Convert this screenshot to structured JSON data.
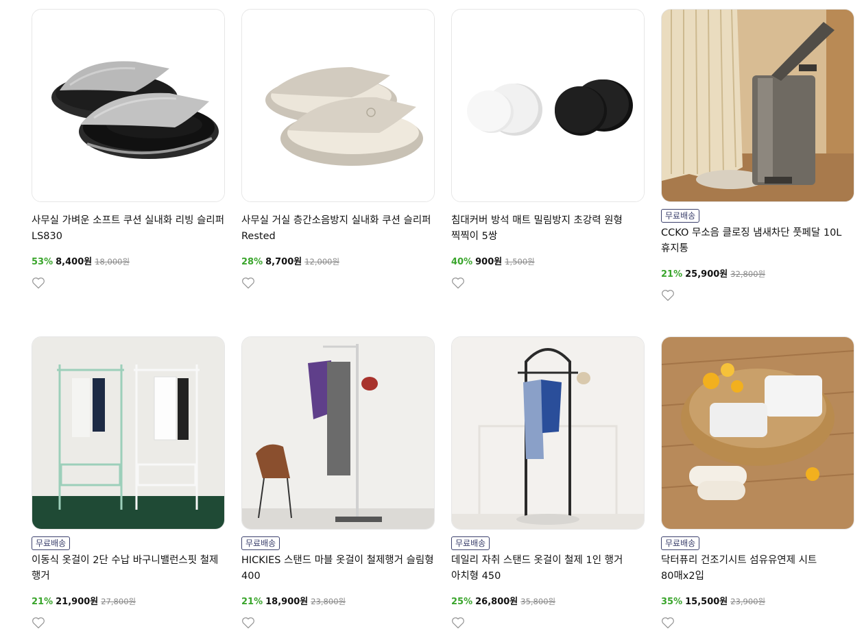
{
  "products": [
    {
      "name": "사무실 가벼운 소프트 쿠션 실내화 리빙 슬리퍼 LS830",
      "discount": "53%",
      "price": "8,400원",
      "original": "18,000원",
      "badge": "",
      "image": "gray-slipper"
    },
    {
      "name": "사무실 거실 층간소음방지 실내화 쿠션 슬리퍼 Rested",
      "discount": "28%",
      "price": "8,700원",
      "original": "12,000원",
      "badge": "",
      "image": "beige-slipper"
    },
    {
      "name": "침대커버 방석 매트 밀림방지 초강력 원형 찍찍이 5쌍",
      "discount": "40%",
      "price": "900원",
      "original": "1,500원",
      "badge": "",
      "image": "velcro-dots"
    },
    {
      "name": "CCKO 무소음 클로징 냄새차단 풋페달 10L 휴지통",
      "discount": "21%",
      "price": "25,900원",
      "original": "32,800원",
      "badge": "무료배송",
      "image": "trash-can"
    },
    {
      "name": "이동식 옷걸이 2단 수납 바구니밸런스핏 철제 행거",
      "discount": "21%",
      "price": "21,900원",
      "original": "27,800원",
      "badge": "무료배송",
      "image": "double-rack"
    },
    {
      "name": "HICKIES 스탠드 마블 옷걸이 철제행거 슬림형 400",
      "discount": "21%",
      "price": "18,900원",
      "original": "23,800원",
      "badge": "무료배송",
      "image": "slim-stand"
    },
    {
      "name": "데일리 자취 스탠드 옷걸이 철제 1인 행거 아치형 450",
      "discount": "25%",
      "price": "26,800원",
      "original": "35,800원",
      "badge": "무료배송",
      "image": "arch-stand"
    },
    {
      "name": "닥터퓨리 건조기시트 섬유유연제 시트 80매x2입",
      "discount": "35%",
      "price": "15,500원",
      "original": "23,900원",
      "badge": "무료배송",
      "image": "dryer-sheets"
    }
  ]
}
